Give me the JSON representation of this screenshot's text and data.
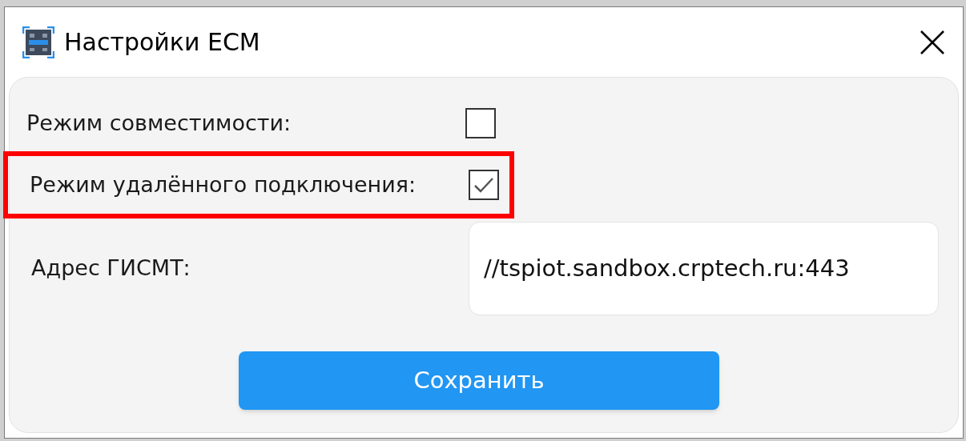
{
  "window": {
    "title": "Настройки ECM"
  },
  "options": [
    {
      "label": "Режим совместимости:",
      "checked": false,
      "highlighted": false
    },
    {
      "label": "Режим удалённого подключения:",
      "checked": true,
      "highlighted": true
    }
  ],
  "address": {
    "label": "Адрес ГИСМТ:",
    "value": "//tspiot.sandbox.crptech.ru:443"
  },
  "save_button": "Сохранить"
}
